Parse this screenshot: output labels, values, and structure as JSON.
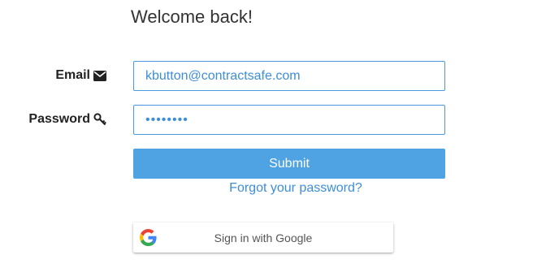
{
  "header": {
    "title": "Welcome back!"
  },
  "form": {
    "email": {
      "label": "Email",
      "icon": "envelope-icon",
      "value": "kbutton@contractsafe.com"
    },
    "password": {
      "label": "Password",
      "icon": "key-icon",
      "value": "••••••••"
    },
    "submit_label": "Submit",
    "forgot_label": "Forgot your password?"
  },
  "google": {
    "label": "Sign in with Google",
    "icon": "google-icon"
  },
  "colors": {
    "accent": "#4fa3e3",
    "link": "#3d8ed8",
    "input_border": "#4a9ae0"
  }
}
